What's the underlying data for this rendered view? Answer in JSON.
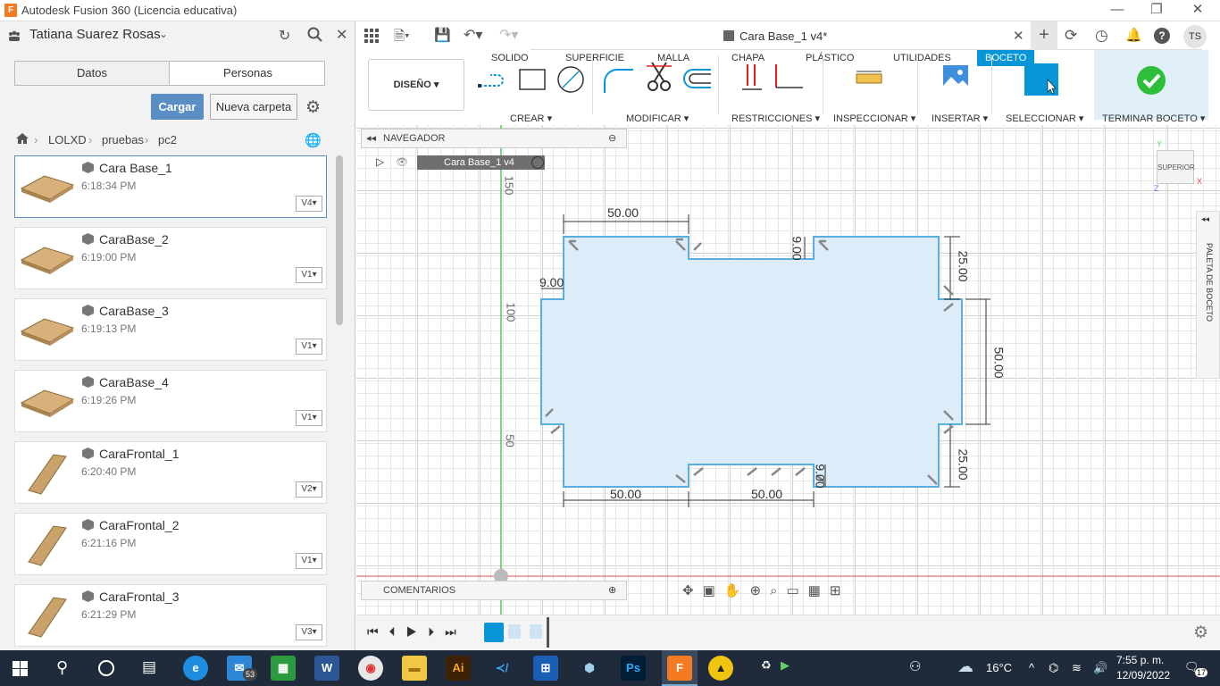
{
  "window": {
    "title": "Autodesk Fusion 360 (Licencia educativa)",
    "logo": "F"
  },
  "left": {
    "user": "Tatiana Suarez Rosas",
    "tabs": [
      "Datos",
      "Personas"
    ],
    "cargar": "Cargar",
    "nueva": "Nueva carpeta",
    "breadcrumb": [
      "LOLXD",
      "pruebas",
      "pc2"
    ],
    "files": [
      {
        "name": "Cara Base_1",
        "time": "6:18:34 PM",
        "ver": "V4"
      },
      {
        "name": "CaraBase_2",
        "time": "6:19:00 PM",
        "ver": "V1"
      },
      {
        "name": "CaraBase_3",
        "time": "6:19:13 PM",
        "ver": "V1"
      },
      {
        "name": "CaraBase_4",
        "time": "6:19:26 PM",
        "ver": "V1"
      },
      {
        "name": "CaraFrontal_1",
        "time": "6:20:40 PM",
        "ver": "V2"
      },
      {
        "name": "CaraFrontal_2",
        "time": "6:21:16 PM",
        "ver": "V1"
      },
      {
        "name": "CaraFrontal_3",
        "time": "6:21:29 PM",
        "ver": "V3"
      }
    ]
  },
  "doc": {
    "tab": "Cara Base_1 v4*",
    "avatar": "TS"
  },
  "menu": {
    "tabs": [
      "SOLIDO",
      "SUPERFICIE",
      "MALLA",
      "CHAPA",
      "PLÁSTICO",
      "UTILIDADES",
      "BOCETO"
    ],
    "design": "DISEÑO",
    "groups": [
      "CREAR",
      "MODIFICAR",
      "RESTRICCIONES",
      "INSPECCIONAR",
      "INSERTAR",
      "SELECCIONAR",
      "TERMINAR BOCETO"
    ]
  },
  "navigator": {
    "title": "NAVEGADOR",
    "item": "Cara Base_1 v4"
  },
  "comments": "COMENTARIOS",
  "viewcube": {
    "face": "SUPERIOR",
    "y": "Y",
    "x": "X",
    "z": "Z"
  },
  "palette": "PALETA DE BOCETO",
  "dims": {
    "top_len": "50.00",
    "small_v": "9.00",
    "small_h": "9.00",
    "r_top": "25.00",
    "r_mid": "50.00",
    "r_bot": "25.00",
    "bot_l": "50.00",
    "bot_r": "50.00",
    "bot_small": "9.00"
  },
  "ruler": [
    "150",
    "100",
    "50"
  ],
  "taskbar": {
    "temp": "16°C",
    "time": "7:55 p. m.",
    "date": "12/09/2022",
    "mail": "53",
    "notif": "17"
  },
  "colors": {
    "accent": "#0696d7",
    "sketch_line": "#5aaee0",
    "sketch_fill": "#dcecf8",
    "green": "#2dbf3a"
  }
}
